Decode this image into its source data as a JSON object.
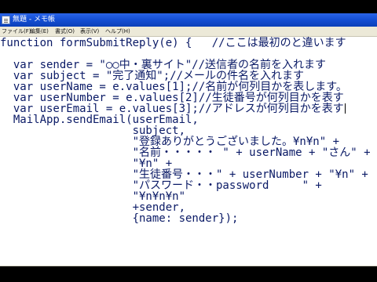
{
  "window": {
    "title": "無題 - メモ帳"
  },
  "menu": [
    "ファイル(F)",
    "編集(E)",
    "書式(O)",
    "表示(V)",
    "ヘルプ(H)"
  ],
  "code": [
    "function formSubmitReply(e) {   //ここは最初のと違います",
    "",
    "  var sender = \"○○中・裏サイト\"//送信者の名前を入れます",
    "  var subject = \"完了通知\";//メールの件名を入れます",
    "  var userName = e.values[1];//名前が何列目かを表します。",
    "  var userNumber = e.values[2]//生徒番号が何列目かを表す",
    "  var userEmail = e.values[3];//アドレスが何列目かを表す",
    "  MailApp.sendEmail(userEmail,",
    "                    subject,",
    "                    \"登録ありがとうございました。¥n¥n\" +",
    "                    \"名前・・・・・ \" + userName + \"さん\" +",
    "                    \"¥n\" +",
    "                    \"生徒番号・・・\" + userNumber + \"¥n\" +",
    "                    \"パスワード・・password     \" +",
    "                    \"¥n¥n¥n\"",
    "                    +sender,",
    "                    {name: sender});"
  ]
}
